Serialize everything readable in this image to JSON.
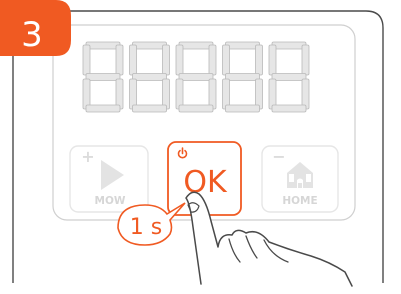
{
  "step": {
    "number": "3",
    "badge_color": "#f05a22"
  },
  "display": {
    "digit_count": 5,
    "segment_color": "#e6e6e6",
    "segment_stroke": "#b9b9b9"
  },
  "buttons": {
    "mow": {
      "label": "MOW",
      "symbol": "+",
      "icon": "play-icon",
      "state": "inactive"
    },
    "ok": {
      "label": "OK",
      "icon": "power-icon",
      "state": "active",
      "accent": "#f05a22"
    },
    "home": {
      "label": "HOME",
      "symbol": "−",
      "icon": "home-icon",
      "state": "inactive"
    }
  },
  "callout": {
    "text": "1 s",
    "color": "#f05a22"
  },
  "colors": {
    "accent": "#f05a22",
    "inactive": "#e3e3e3",
    "outline": "#4a4a4a"
  }
}
